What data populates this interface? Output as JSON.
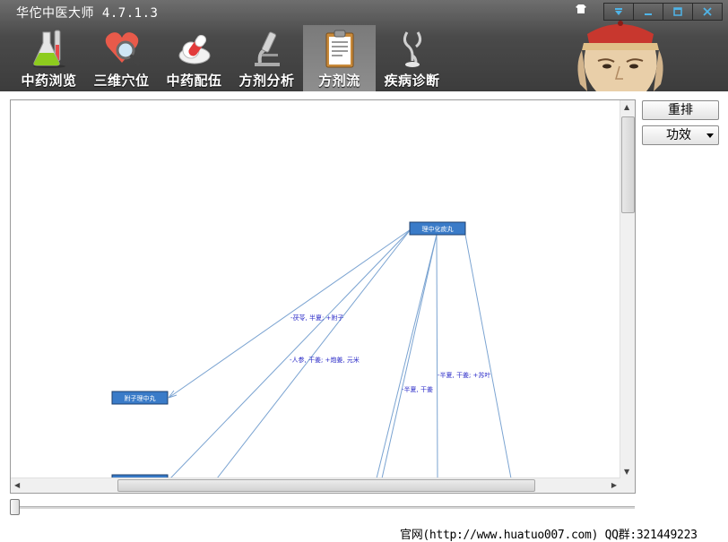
{
  "window": {
    "title": "华佗中医大师 4.7.1.3"
  },
  "tabs": [
    {
      "label": "中药浏览",
      "icon": "flask-icon"
    },
    {
      "label": "三维穴位",
      "icon": "heart-magnifier-icon"
    },
    {
      "label": "中药配伍",
      "icon": "pills-icon"
    },
    {
      "label": "方剂分析",
      "icon": "microscope-icon"
    },
    {
      "label": "方剂流",
      "icon": "clipboard-icon",
      "active": true
    },
    {
      "label": "疾病诊断",
      "icon": "stethoscope-icon"
    }
  ],
  "toolbar": {
    "reset_label": "重排",
    "function_select": "功效"
  },
  "diagram": {
    "nodes": [
      {
        "id": "n0",
        "label": "理中化痰丸"
      },
      {
        "id": "n1",
        "label": "附子理中丸"
      },
      {
        "id": "n2",
        "label": ""
      }
    ],
    "edges": [
      {
        "label": "-茯苓, 半夏; +附子"
      },
      {
        "label": "-人参, 干姜; +炮姜, 元米"
      },
      {
        "label": "-半夏, 干姜"
      },
      {
        "label": "-半夏, 干姜; +苏叶"
      }
    ]
  },
  "footer": {
    "text": "官网(http://www.huatuo007.com) QQ群:321449223"
  },
  "colors": {
    "titlebar": "#4a4a4a",
    "node_fill": "#3a7bc8",
    "edge": "#7aa3d1",
    "edge_label": "#2b2bc8"
  }
}
